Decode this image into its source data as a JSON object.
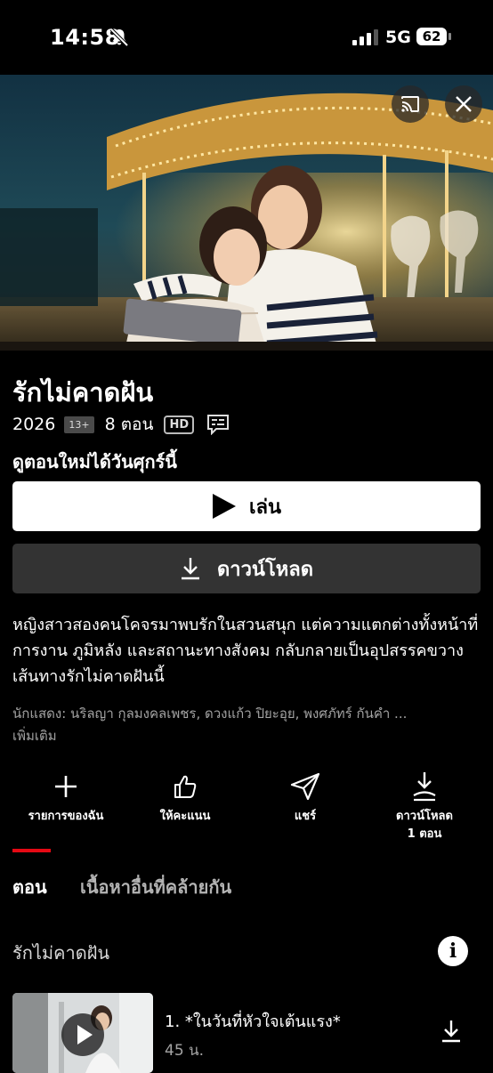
{
  "status_bar": {
    "time": "14:58",
    "network": "5G",
    "battery": "62",
    "icons": [
      "bell-slash-icon",
      "signal-icon",
      "battery-icon"
    ]
  },
  "hero": {
    "icons": [
      "cast-icon",
      "close-icon"
    ]
  },
  "title": "รักไม่คาดฝัน",
  "meta": {
    "year": "2026",
    "age_rating": "13+",
    "episodes": "8 ตอน",
    "quality": "HD"
  },
  "notice": "ดูตอนใหม่ได้วันศุกร์นี้",
  "buttons": {
    "play": "เล่น",
    "download": "ดาวน์โหลด"
  },
  "synopsis": "หญิงสาวสองคนโคจรมาพบรักในสวนสนุก แต่ความแตกต่างทั้งหน้าที่การงาน ภูมิหลัง และสถานะทางสังคม กลับกลายเป็นอุปสรรคขวางเส้นทางรักไม่คาดฝันนี้",
  "cast": "นักแสดง: นริลญา กุลมงคลเพชร, ดวงแก้ว ปิยะอุย, พงศภัทร์ กันคำ ...",
  "more": "เพิ่มเติม",
  "actions": {
    "my_list": "รายการของฉัน",
    "rate": "ให้คะแนน",
    "share": "แชร์",
    "download_line1": "ดาวน์โหลด",
    "download_line2": "1 ตอน"
  },
  "tabs": {
    "episodes": "ตอน",
    "similar": "เนื้อหาอื่นที่คล้ายกัน"
  },
  "season": {
    "title": "รักไม่คาดฝัน",
    "info": "i"
  },
  "episode_list": [
    {
      "title": "1. *ในวันที่หัวใจเต้นแรง*",
      "duration": "45 น."
    }
  ],
  "colors": {
    "background": "#000000",
    "accent": "#e50914",
    "secondary_button": "#333333",
    "muted_text": "#a3a3a3"
  }
}
